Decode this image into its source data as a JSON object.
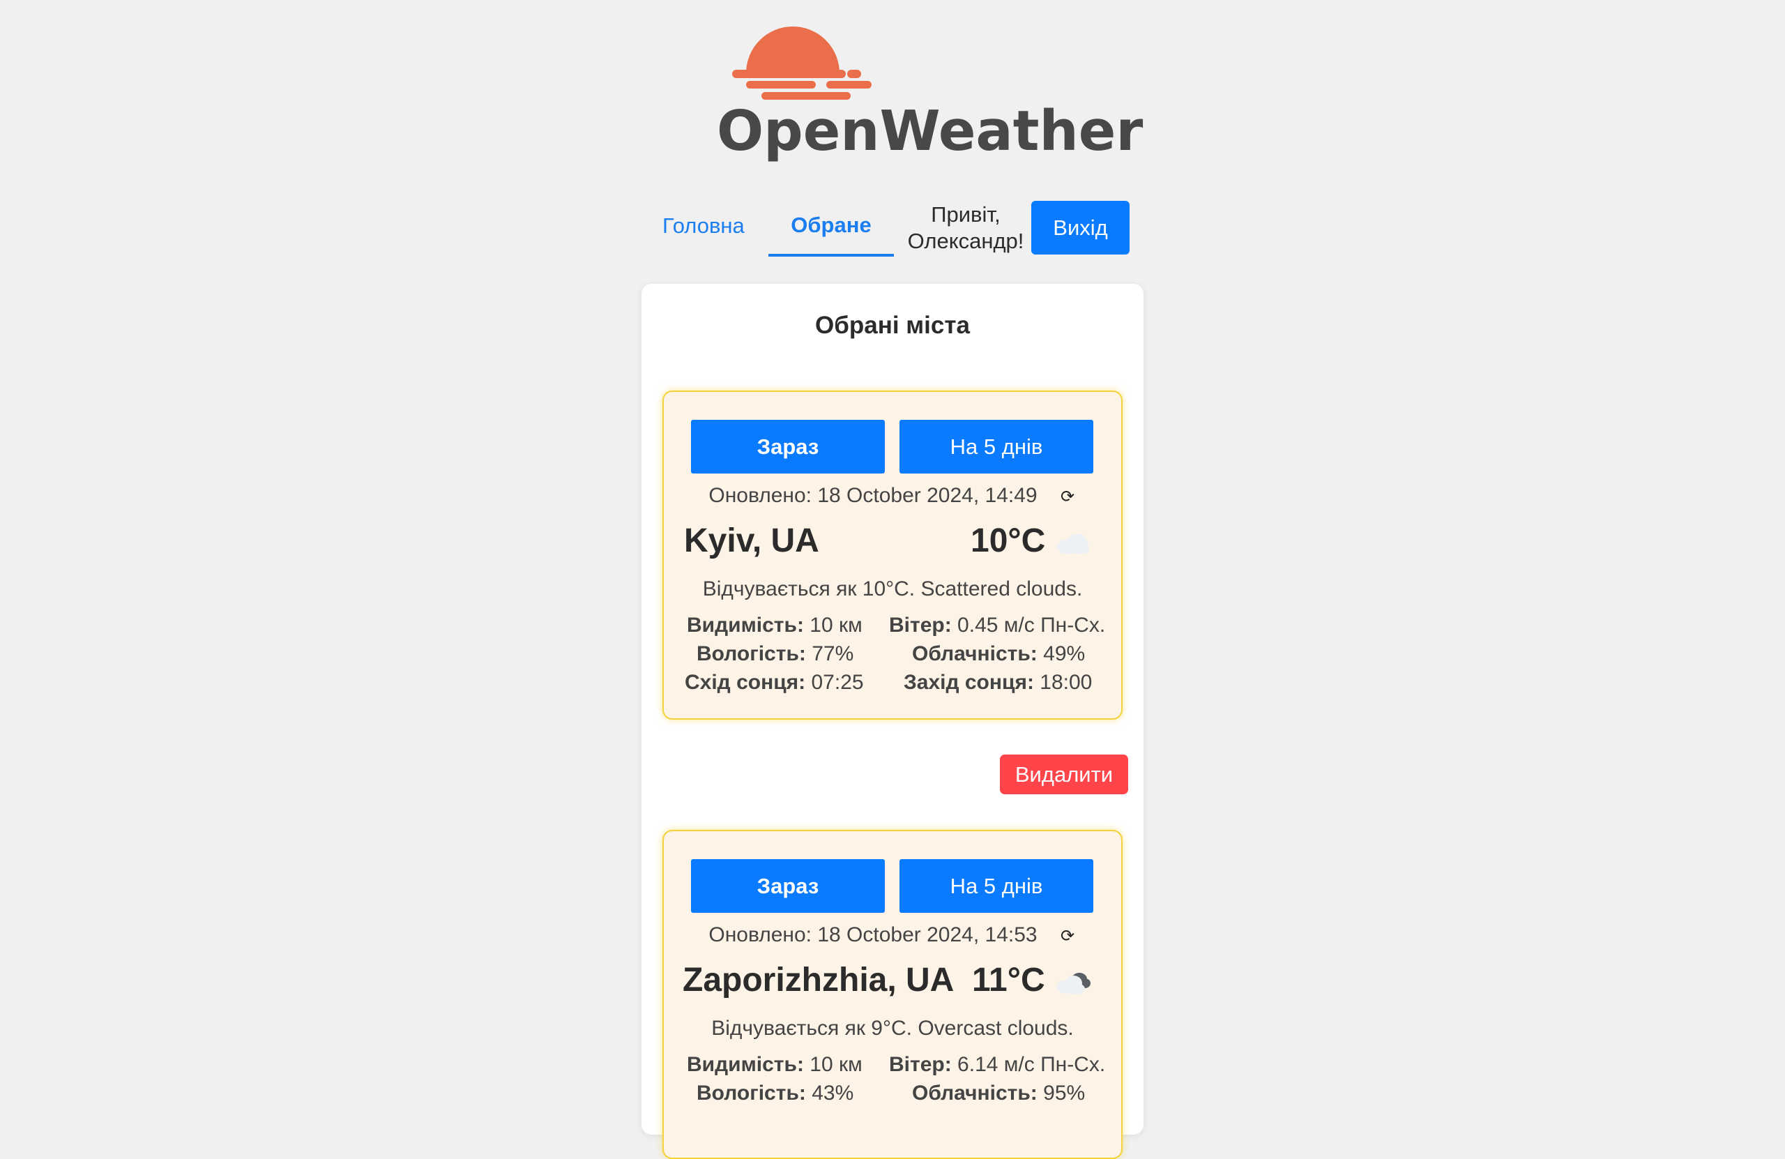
{
  "brand": {
    "name": "OpenWeather",
    "logo_color": "#eb6e4b"
  },
  "nav": {
    "home": "Головна",
    "favorites": "Обране",
    "greeting": "Привіт, Олександр!",
    "logout": "Вихід"
  },
  "panel": {
    "title": "Обрані міста"
  },
  "cities": [
    {
      "btn_now": "Зараз",
      "btn_5day": "На 5 днів",
      "updated": "Оновлено: 18 October 2024, 14:49",
      "refresh_icon": "⟳",
      "name": "Kyiv, UA",
      "temp": "10°C",
      "icon": "scattered-clouds-icon",
      "feels": "Відчувається як 10°C. Scattered clouds.",
      "visibility_label": "Видимість:",
      "visibility": "10 км",
      "wind_label": "Вітер:",
      "wind": "0.45 м/с Пн-Сх.",
      "humidity_label": "Вологість:",
      "humidity": "77%",
      "clouds_label": "Облачність:",
      "clouds": "49%",
      "sunrise_label": "Схід сонця:",
      "sunrise": "07:25",
      "sunset_label": "Захід сонця:",
      "sunset": "18:00"
    },
    {
      "btn_now": "Зараз",
      "btn_5day": "На 5 днів",
      "updated": "Оновлено: 18 October 2024, 14:53",
      "refresh_icon": "⟳",
      "name": "Zaporizhzhia, UA",
      "temp": "11°C",
      "icon": "overcast-clouds-icon",
      "feels": "Відчувається як 9°C. Overcast clouds.",
      "visibility_label": "Видимість:",
      "visibility": "10 км",
      "wind_label": "Вітер:",
      "wind": "6.14 м/с Пн-Сх.",
      "humidity_label": "Вологість:",
      "humidity": "43%",
      "clouds_label": "Облачність:",
      "clouds": "95%"
    }
  ],
  "remove_button": "Видалити",
  "colors": {
    "primary": "#0a7bff",
    "danger": "#ff4549",
    "card_bg": "#fdf3e6",
    "card_border": "#f3d23a",
    "page_bg": "#f0f0f0"
  }
}
